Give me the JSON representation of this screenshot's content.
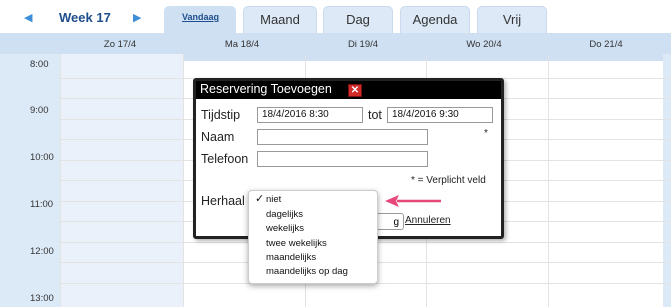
{
  "nav": {
    "prev_icon": "triangle-left-icon",
    "next_icon": "triangle-right-icon",
    "week_label": "Week 17",
    "today_label": "Vandaag"
  },
  "tabs": [
    {
      "label": "Maand"
    },
    {
      "label": "Dag"
    },
    {
      "label": "Agenda"
    },
    {
      "label": "Vrij"
    }
  ],
  "days": [
    "Zo 17/4",
    "Ma 18/4",
    "Di 19/4",
    "Wo 20/4",
    "Do 21/4"
  ],
  "times": [
    "8:00",
    "9:00",
    "10:00",
    "11:00",
    "12:00",
    "13:00"
  ],
  "dialog": {
    "title": "Reservering Toevoegen",
    "close_icon": "close-icon",
    "tijdstip_label": "Tijdstip",
    "start_value": "18/4/2016  8:30",
    "tot_label": "tot",
    "end_value": "18/4/2016  9:30",
    "naam_label": "Naam",
    "naam_value": "",
    "required_mark": "*",
    "telefoon_label": "Telefoon",
    "telefoon_value": "",
    "required_note": "* = Verplicht veld",
    "herhaal_label": "Herhaal",
    "save_partial": "g",
    "cancel_label": "Annuleren"
  },
  "repeat_dropdown": {
    "selected": "niet",
    "check_icon": "checkmark-icon",
    "options": [
      "niet",
      "dagelijks",
      "wekelijks",
      "twee wekelijks",
      "maandelijks",
      "maandelijks op dag"
    ]
  },
  "annotation": {
    "arrow_icon": "pink-arrow-icon",
    "color": "#e8477a"
  },
  "colors": {
    "header_bg": "#cfe0f3",
    "tab_bg": "#dde9f7",
    "accent": "#1f4e8c",
    "close_red": "#d02a2a"
  }
}
